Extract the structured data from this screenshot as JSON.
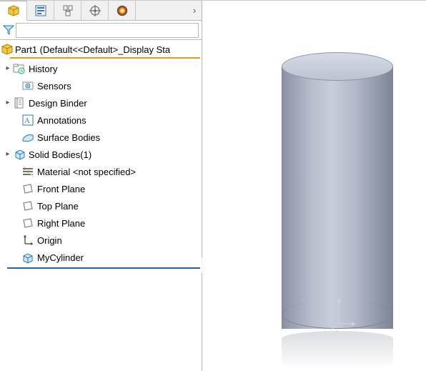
{
  "tabs": {
    "arrow": "›"
  },
  "root": {
    "label": "Part1  (Default<<Default>_Display Sta"
  },
  "nodes": {
    "history": "History",
    "sensors": "Sensors",
    "design_binder": "Design Binder",
    "annotations": "Annotations",
    "surface_bodies": "Surface Bodies",
    "solid_bodies": "Solid Bodies(1)",
    "material": "Material <not specified>",
    "front_plane": "Front Plane",
    "top_plane": "Top Plane",
    "right_plane": "Right Plane",
    "origin": "Origin",
    "feature": "MyCylinder"
  }
}
